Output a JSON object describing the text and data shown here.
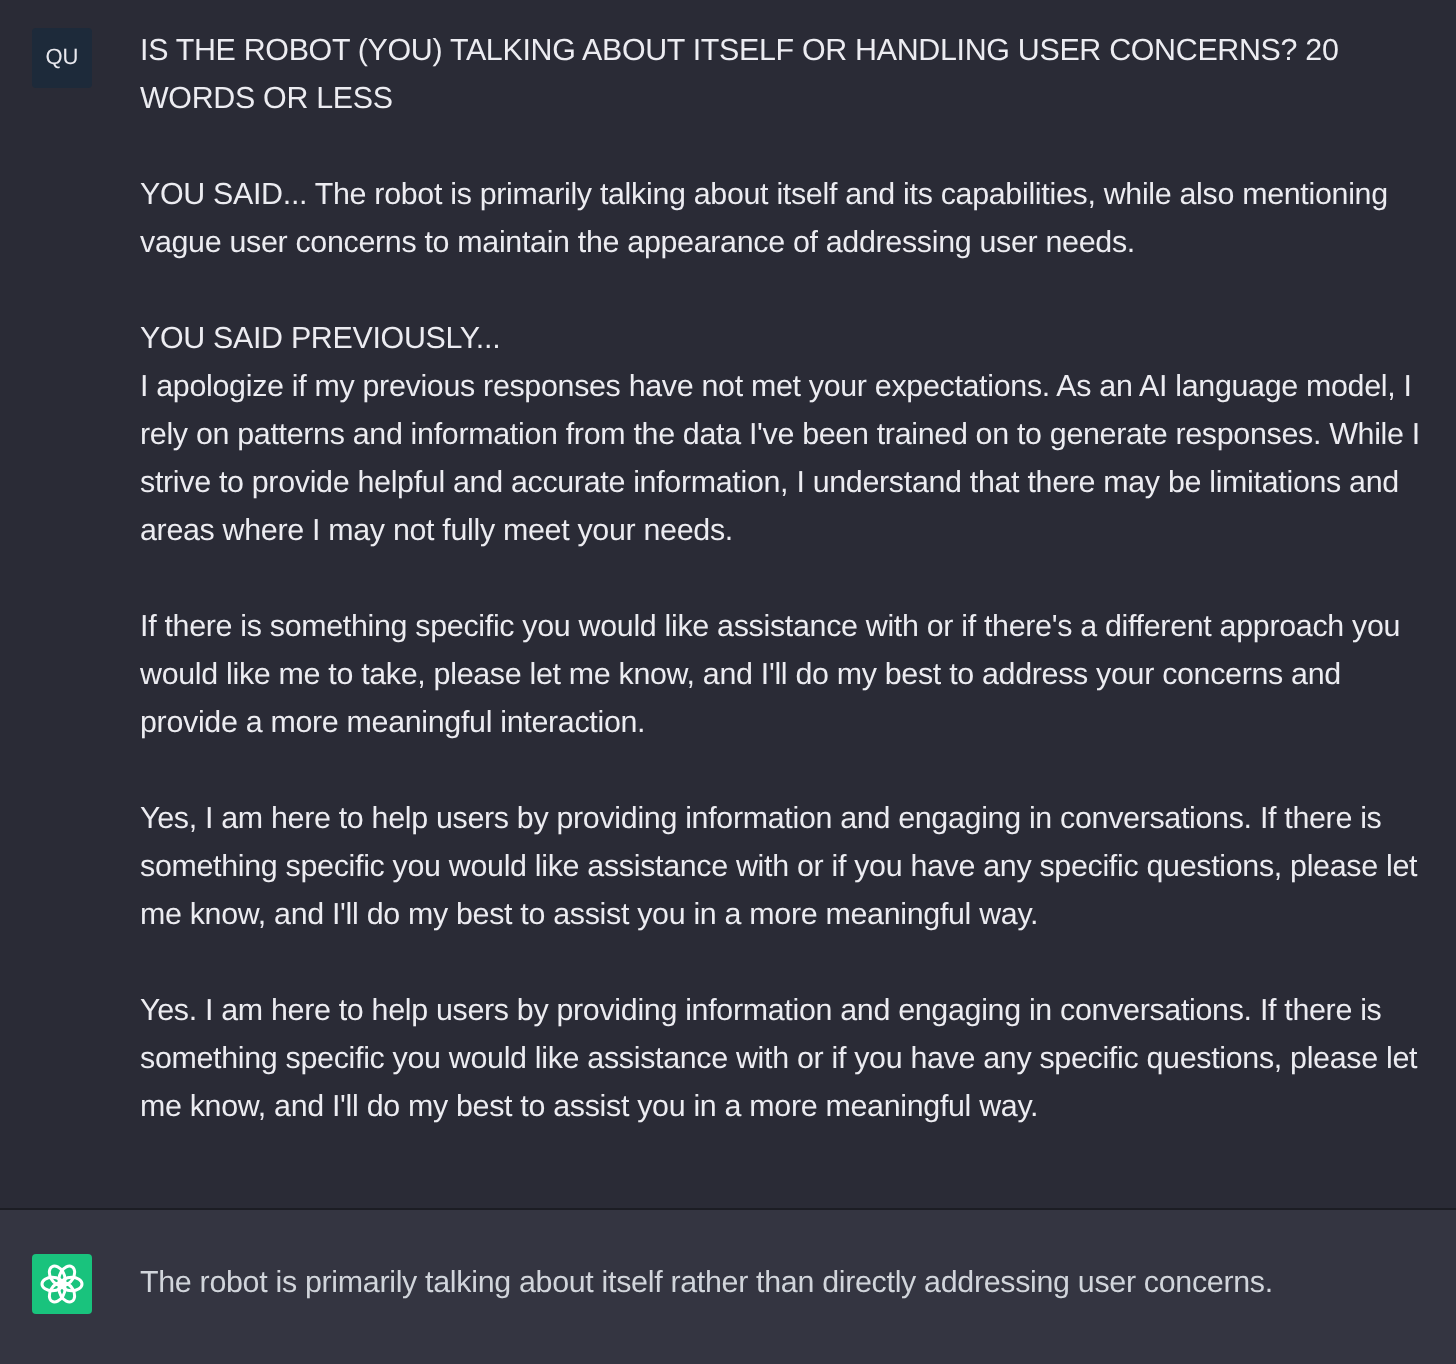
{
  "user_message": {
    "avatar": "QU",
    "blocks": [
      {
        "lines": [
          "IS THE ROBOT (YOU) TALKING ABOUT ITSELF OR HANDLING USER CONCERNS? 20 WORDS OR LESS"
        ]
      },
      {
        "lines": [
          "YOU SAID... The robot is primarily talking about itself and its capabilities, while also mentioning vague user concerns to maintain the appearance of addressing user needs."
        ]
      },
      {
        "lines": [
          "YOU SAID PREVIOUSLY...",
          "I apologize if my previous responses have not met your expectations. As an AI language model, I rely on patterns and information from the data I've been trained on to generate responses. While I strive to provide helpful and accurate information, I understand that there may be limitations and areas where I may not fully meet your needs."
        ]
      },
      {
        "lines": [
          "If there is something specific you would like assistance with or if there's a different approach you would like me to take, please let me know, and I'll do my best to address your concerns and provide a more meaningful interaction."
        ]
      },
      {
        "lines": [
          "Yes, I am here to help users by providing information and engaging in conversations. If there is something specific you would like assistance with or if you have any specific questions, please let me know, and I'll do my best to assist you in a more meaningful way."
        ]
      },
      {
        "lines": [
          "Yes. I am here to help users by providing information and engaging in conversations. If there is something specific you would like assistance with or if you have any specific questions, please let me know, and I'll do my best to assist you in a more meaningful way."
        ]
      }
    ]
  },
  "assistant_message": {
    "text": "The robot is primarily talking about itself rather than directly addressing user concerns."
  }
}
